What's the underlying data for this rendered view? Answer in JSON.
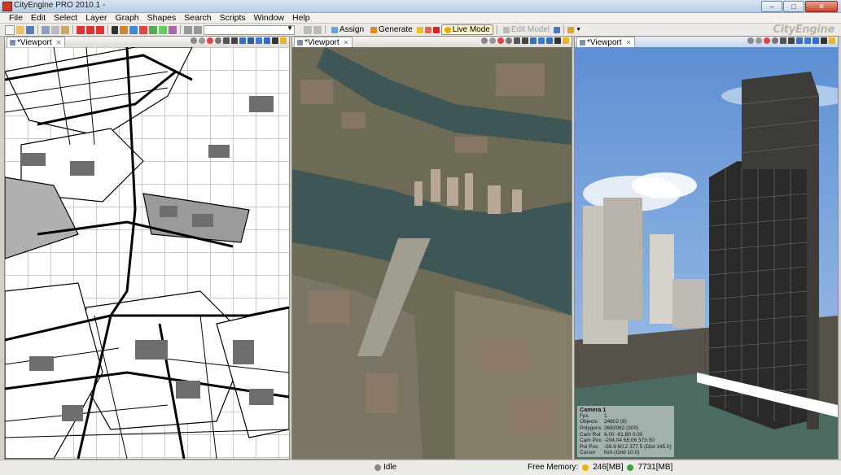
{
  "window": {
    "title": "CityEngine PRO 2010.1 -",
    "brand": "CityEngine"
  },
  "menu": [
    "File",
    "Edit",
    "Select",
    "Layer",
    "Graph",
    "Shapes",
    "Search",
    "Scripts",
    "Window",
    "Help"
  ],
  "toolbar": {
    "assign_label": "Assign",
    "generate_label": "Generate",
    "live_mode_label": "Live Mode",
    "edit_model_label": "Edit Model"
  },
  "viewports": [
    {
      "tab_label": "*Viewport",
      "close": "✕"
    },
    {
      "tab_label": "*Viewport",
      "close": "✕"
    },
    {
      "tab_label": "*Viewport",
      "close": "✕"
    }
  ],
  "camera_info": {
    "title": "Camera 1",
    "rows": [
      {
        "k": "Fps",
        "v": "1"
      },
      {
        "k": "Objects",
        "v": "24802 (8)"
      },
      {
        "k": "Polygons",
        "v": "2682062 (300)"
      },
      {
        "k": "Cam Rot",
        "v": "6.00 -91.80 0.00"
      },
      {
        "k": "Cam Pos",
        "v": "-204.04 65.06 373.00"
      },
      {
        "k": "Poi Pos",
        "v": "-59.9 60.2 377.5 (Dist 145.0)"
      },
      {
        "k": "Cursor",
        "v": "N/A (Grid 10.0)"
      }
    ]
  },
  "status": {
    "state": "Idle",
    "free_memory_label": "Free Memory:",
    "mem_yellow": "246[MB]",
    "mem_green": "7731[MB]"
  },
  "colors": {
    "accent_title": "#c2d4ee",
    "mem_yellow": "#e6b800",
    "mem_green": "#3aa33a"
  }
}
